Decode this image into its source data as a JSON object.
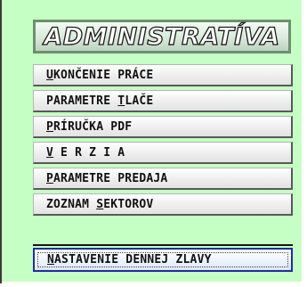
{
  "header": {
    "title": "ADMINISTRATÍVA"
  },
  "menu": {
    "items": [
      {
        "pre": "",
        "key": "U",
        "post": "KONČENIE PRÁCE"
      },
      {
        "pre": "PARAMETRE ",
        "key": "T",
        "post": "LAČE"
      },
      {
        "pre": "",
        "key": "P",
        "post": "RÍRUČKA PDF"
      },
      {
        "pre": "",
        "key": "V",
        "post": " E R Z I A"
      },
      {
        "pre": "",
        "key": "P",
        "post": "ARAMETRE PREDAJA"
      },
      {
        "pre": "ZOZNAM ",
        "key": "S",
        "post": "EKTOROV"
      },
      {
        "pre": "",
        "key": "N",
        "post": "ASTAVENIE DENNEJ ZLAVY"
      }
    ],
    "active_index": 6
  },
  "colors": {
    "panel_bg": "#c6ffc3",
    "header_border": "#6e8f72",
    "active_border": "#1b2fa0"
  }
}
